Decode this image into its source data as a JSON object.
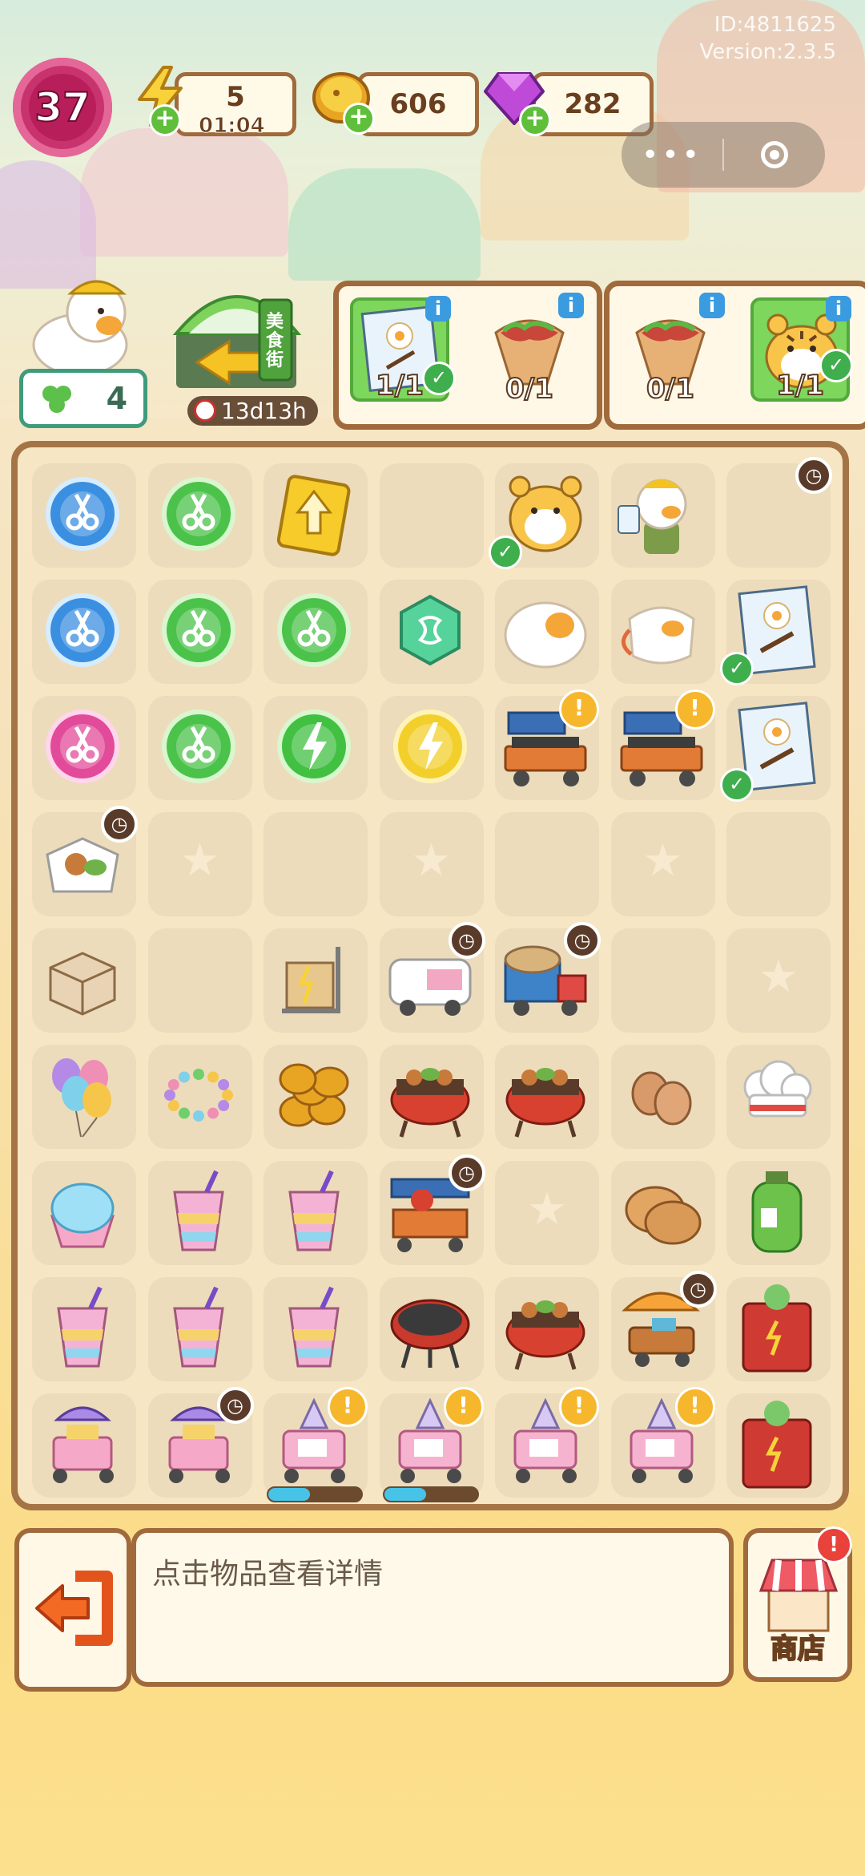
{
  "app": {
    "id_line": "ID:4811625",
    "version_line": "Version:2.3.5"
  },
  "header": {
    "level": "37",
    "energy": "5",
    "energy_timer": "01:04",
    "coins": "606",
    "gems": "282"
  },
  "miniprogram_capsule": {
    "more_label": "•••"
  },
  "character": {
    "clover_count": "4"
  },
  "event_gate": {
    "sign_text": "美食街",
    "timer": "13d13h"
  },
  "orders": [
    {
      "slots": [
        {
          "count": "1/1",
          "done": true,
          "icon": "bbq-poster-icon"
        },
        {
          "count": "0/1",
          "done": false,
          "icon": "burrito-icon"
        }
      ]
    },
    {
      "slots": [
        {
          "count": "0/1",
          "done": false,
          "icon": "burrito-icon"
        },
        {
          "count": "1/1",
          "done": true,
          "icon": "tiger-plush-icon"
        }
      ]
    }
  ],
  "board": {
    "rows": [
      [
        "blue-scissors-orb",
        "green-scissors-orb",
        "yellow-arrow-card",
        "",
        "tiger-plush",
        "duck-chef",
        "duck-chef-timer"
      ],
      [
        "blue-scissors-orb",
        "green-scissors-orb",
        "green-scissors-orb",
        "green-hexagon-gem",
        "egg-bun",
        "duck-mask",
        "bbq-poster"
      ],
      [
        "pink-scissors-orb",
        "green-scissors-orb",
        "green-energy-orb",
        "yellow-energy-orb",
        "bbq-grill-cart",
        "bbq-grill-cart",
        "bbq-poster"
      ],
      [
        "takeout-box",
        "star-slot",
        "",
        "star-slot",
        "",
        "star-slot",
        ""
      ],
      [
        "cardboard-box",
        "",
        "hand-truck-boxes",
        "food-truck",
        "delivery-truck",
        "",
        "star-slot"
      ],
      [
        "balloons",
        "bead-bracelet",
        "coin-stack",
        "bbq-grill-feast",
        "bbq-grill-feast",
        "eggs",
        "chef-hat"
      ],
      [
        "shaved-ice",
        "rainbow-drink",
        "rainbow-drink",
        "bbq-stall",
        "star-slot",
        "pancakes",
        "gas-canister"
      ],
      [
        "rainbow-drink",
        "rainbow-drink",
        "rainbow-drink",
        "charcoal-grill",
        "bbq-grill-feast",
        "food-cart-umbrella",
        "red-cabinet"
      ],
      [
        "ice-cream-cart",
        "ice-cream-cart",
        "pink-cart",
        "pink-cart",
        "pink-cart",
        "pink-cart",
        "red-cabinet"
      ]
    ]
  },
  "details": {
    "hint": "点击物品查看详情"
  },
  "shop": {
    "label": "商店"
  },
  "progress": {
    "cart1": 0.45,
    "cart2": 0.45
  },
  "colors": {
    "board_border": "#a57446",
    "accent_green": "#5fbf3a",
    "level_pink": "#c8336e"
  }
}
